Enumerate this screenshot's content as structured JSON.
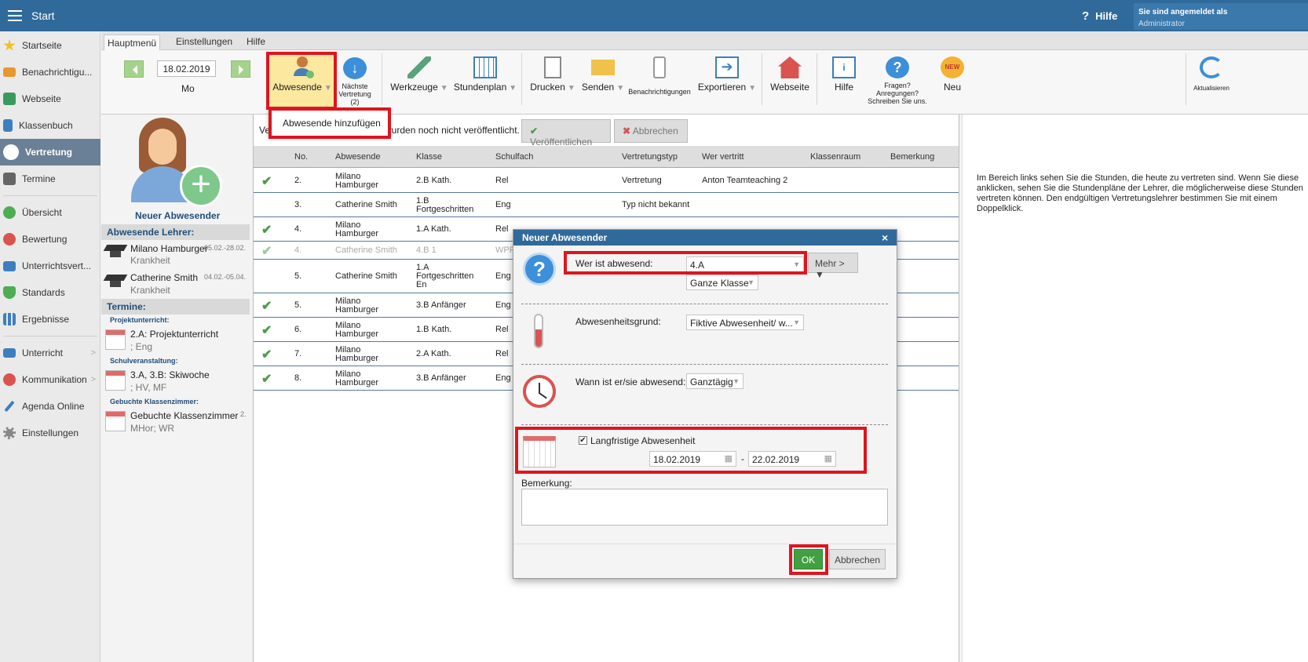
{
  "topbar": {
    "title": "Start",
    "help": "Hilfe",
    "signed_in_as": "Sie sind angemeldet als",
    "user": "Administrator"
  },
  "sidebar": {
    "items": [
      {
        "label": "Startseite"
      },
      {
        "label": "Benachrichtigu..."
      },
      {
        "label": "Webseite"
      },
      {
        "label": "Klassenbuch"
      },
      {
        "label": "Vertretung"
      },
      {
        "label": "Termine"
      },
      {
        "label": "Übersicht"
      },
      {
        "label": "Bewertung"
      },
      {
        "label": "Unterrichtsvert..."
      },
      {
        "label": "Standards"
      },
      {
        "label": "Ergebnisse"
      },
      {
        "label": "Unterricht"
      },
      {
        "label": "Kommunikation"
      },
      {
        "label": "Agenda Online"
      },
      {
        "label": "Einstellungen"
      }
    ]
  },
  "ribbon": {
    "tabs": [
      "Hauptmenü",
      "Einstellungen",
      "Hilfe"
    ],
    "date": "18.02.2019",
    "day": "Mo",
    "abwesende": "Abwesende",
    "naechste": [
      "Nächste",
      "Vertretung",
      "(2)"
    ],
    "werkzeuge": "Werkzeuge",
    "stundenplan": "Stundenplan",
    "drucken": "Drucken",
    "senden": "Senden",
    "benachrichtigungen": "Benachrichtigungen",
    "exportieren": "Exportieren",
    "webseite": "Webseite",
    "hilfe": "Hilfe",
    "fragen": [
      "Fragen?",
      "Anregungen?",
      "Schreiben Sie uns."
    ],
    "neu": "Neu",
    "neu_badge": "NEW",
    "aktualisieren": "Aktualisieren"
  },
  "dropdown": {
    "item": "Abwesende hinzufügen"
  },
  "left": {
    "new_absent": "Neuer Abwesender",
    "absent_teachers_header": "Abwesende Lehrer:",
    "teachers": [
      {
        "name": "Milano Hamburger",
        "dates": "05.02.-28.02.",
        "reason": "Krankheit"
      },
      {
        "name": "Catherine Smith",
        "dates": "04.02.-05.04.",
        "reason": "Krankheit"
      }
    ],
    "termine_header": "Termine:",
    "termine": [
      {
        "category": "Projektunterricht:",
        "title": "2.A: Projektunterricht",
        "sub": "; Eng",
        "extra": ""
      },
      {
        "category": "Schulveranstaltung:",
        "title": "3.A, 3.B: Skiwoche",
        "sub": "; HV, MF",
        "extra": ""
      },
      {
        "category": "Gebuchte Klassenzimmer:",
        "title": "Gebuchte Klassenzimmer",
        "sub": "MHor; WR",
        "extra": "2."
      }
    ]
  },
  "main": {
    "notice_pre": "Ve",
    "notice_post": "wurden noch nicht veröffentlicht.",
    "publish": "Veröffentlichen",
    "cancel": "Abbrechen",
    "headers": [
      "No.",
      "Abwesende",
      "Klasse",
      "Schulfach",
      "Vertretungstyp",
      "Wer vertritt",
      "Klassenraum",
      "Bemerkung"
    ],
    "rows": [
      {
        "check": "✔",
        "no": "2.",
        "abw": [
          "Milano",
          "Hamburger"
        ],
        "klasse": [
          "2.B Kath."
        ],
        "fach": "Rel",
        "typ": "Vertretung",
        "wer": "Anton Teamteaching 2"
      },
      {
        "check": "",
        "no": "3.",
        "abw": [
          "Catherine Smith"
        ],
        "klasse": [
          "1.B",
          "Fortgeschritten"
        ],
        "fach": "Eng",
        "typ": "Typ nicht bekannt",
        "wer": ""
      },
      {
        "check": "✔",
        "no": "4.",
        "abw": [
          "Milano",
          "Hamburger"
        ],
        "klasse": [
          "1.A Kath."
        ],
        "fach": "Rel",
        "typ": "",
        "wer": ""
      },
      {
        "check": "✔",
        "no": "4.",
        "abw": [
          "Catherine Smith"
        ],
        "klasse": [
          "4.B 1"
        ],
        "fach": "WPF",
        "typ": "",
        "wer": ""
      },
      {
        "check": "",
        "no": "5.",
        "abw": [
          "Catherine Smith"
        ],
        "klasse": [
          "1.A",
          "Fortgeschritten",
          "En"
        ],
        "fach": "Eng",
        "typ": "",
        "wer": ""
      },
      {
        "check": "✔",
        "no": "5.",
        "abw": [
          "Milano",
          "Hamburger"
        ],
        "klasse": [
          "3.B Anfänger"
        ],
        "fach": "Eng",
        "typ": "",
        "wer": ""
      },
      {
        "check": "✔",
        "no": "6.",
        "abw": [
          "Milano",
          "Hamburger"
        ],
        "klasse": [
          "1.B Kath."
        ],
        "fach": "Rel",
        "typ": "",
        "wer": ""
      },
      {
        "check": "✔",
        "no": "7.",
        "abw": [
          "Milano",
          "Hamburger"
        ],
        "klasse": [
          "2.A Kath."
        ],
        "fach": "Rel",
        "typ": "",
        "wer": ""
      },
      {
        "check": "✔",
        "no": "8.",
        "abw": [
          "Milano",
          "Hamburger"
        ],
        "klasse": [
          "3.B Anfänger"
        ],
        "fach": "Eng",
        "typ": "",
        "wer": ""
      }
    ]
  },
  "right": {
    "text": "Im Bereich links sehen Sie die Stunden, die heute zu vertreten sind. Wenn Sie diese anklicken, sehen Sie die Stundenpläne der Lehrer, die möglicherweise diese Stunden vertreten können. Den endgültigen Vertretungslehrer bestimmen Sie mit einem Doppelklick."
  },
  "dialog": {
    "title": "Neuer Abwesender",
    "close": "×",
    "wer_label": "Wer ist abwesend:",
    "wer_value": "4.A",
    "mehr": "Mehr > ▼",
    "scope": "Ganze Klasse",
    "grund_label": "Abwesenheitsgrund:",
    "grund_value": "Fiktive Abwesenheit/ w...",
    "wann_label": "Wann ist er/sie abwesend:",
    "wann_value": "Ganztägig",
    "longterm_label": "Langfristige Abwesenheit",
    "longterm_checked": true,
    "from": "18.02.2019",
    "dash": "-",
    "to": "22.02.2019",
    "remark_label": "Bemerkung:",
    "ok": "OK",
    "cancel": "Abbrechen"
  },
  "colors": {
    "topbar": "#2f6a9b",
    "highlight": "#e0141e",
    "ok": "#41a042",
    "active_sidebar": "#6a8096"
  }
}
